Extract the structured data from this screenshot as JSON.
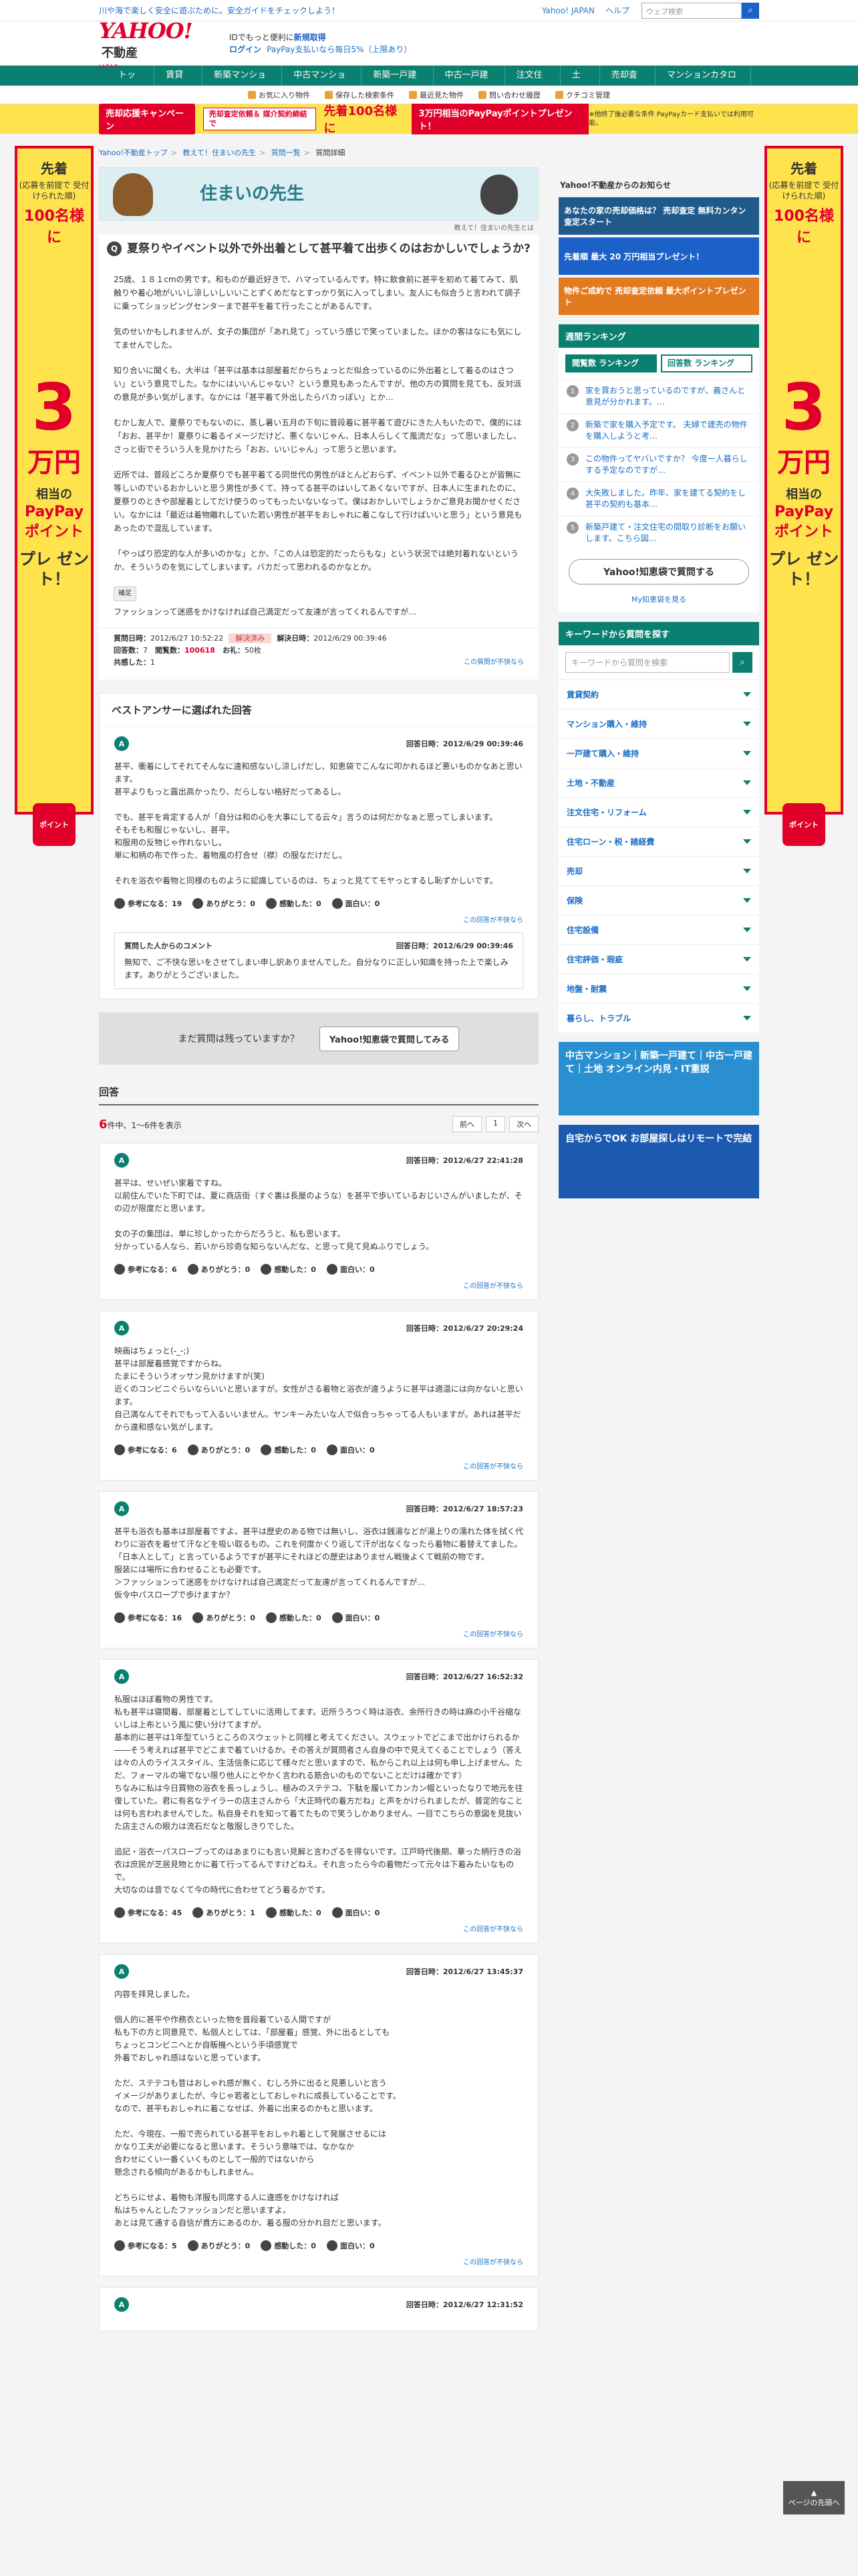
{
  "topbar": {
    "msg": "川や海で楽しく安全に遊ぶために。安全ガイドをチェックしよう！",
    "yahoo": "Yahoo! JAPAN",
    "help": "ヘルプ",
    "search_placeholder": "ウェブ検索"
  },
  "header": {
    "logo": "YAHOO!",
    "logo_sub": "JAPAN",
    "category": "不動産",
    "l1": "IDでもっと便利に",
    "l1b": "新規取得",
    "login": "ログイン",
    "paypay": "PayPay支払いなら毎日5%（上限あり）"
  },
  "gnav": [
    "トップ",
    "賃貸 ▼",
    "新築マンション",
    "中古マンション",
    "新築一戸建て",
    "中古一戸建て",
    "注文住宅",
    "土地",
    "売却査定",
    "マンションカタログ"
  ],
  "subnav": [
    "お気に入り物件",
    "保存した検索条件",
    "最近見た物件",
    "問い合わせ履歴",
    "クチコミ管理"
  ],
  "banner": {
    "b1": "売却応援キャンペーン",
    "b2": "売却査定依頼＆\n媒介契約締結で",
    "b3": "先着100名様に",
    "b4": "3万円相当のPayPayポイントプレゼント！",
    "b5": "※他終了後必要な条件\nPayPayカード支払いでは利用可能。"
  },
  "sidead": {
    "a1": "先着",
    "a2": "(応募を前提で\n受付けられた順)",
    "a3": "100名様に",
    "a4": "3",
    "a5": "万円",
    "a6": "相当の",
    "a7": "PayPay\nポイント",
    "a8": "プレ\nゼント！",
    "logo": "ポイント"
  },
  "breadcrumb": [
    "Yahoo!不動産トップ",
    "教えて！住まいの先生",
    "質問一覧",
    "質問詳細"
  ],
  "teach": {
    "title": "住まいの先生",
    "note": "教えて！住まいの先生とは"
  },
  "question": {
    "title": "夏祭りやイベント以外で外出着として甚平着て出歩くのはおかしいでしょうか?",
    "paras": [
      "25歳、１８１cmの男です。和ものが最近好きで、ハマっているんです。特に飲食前に甚平を初めて着てみて、肌触りや着心地がいいし涼しいしいいことずくめだなとすっかり気に入ってしまい。友人にも似合うと言われて調子に乗ってショッピングセンターまで甚平を着て行ったことがあるんです。",
      "気のせいかもしれませんが、女子の集団が「あれ見て」っていう感じで笑っていました。ほかの客はなにも気にしてませんでした。",
      "知り合いに聞くも、大半は「甚平は基本は部屋着だからちょっとだ似合っているのに外出着として着るのはさつい」という意見でした。なかにはいいんじゃない？という意見もあったんですが、他の方の質問を見ても、反対派の意見が多い気がします。なかには「甚平着て外出したらバカっぽい」とか…",
      "むかし友人で、夏祭りでもないのに、蒸し暑い五月の下旬に普段着に甚平着て遊びにきた人もいたので、僕的には「おお、甚平か！夏祭りに着るイメージだけど、悪くないじゃん、日本人らしくて風流だな」って思いましたし、さっと街でそういう人を見かけたら「おお、いいじゃん」って思うと思います。",
      "近所では、普段どころか夏祭りでも甚平着てる同世代の男性がほとんどおらず、イベント以外で着るひとが皆無に等しいのでいるおかしいと思う男性が多くて、持ってる甚平のはいしてあくないですが、日本人に生まれたのに、夏祭りのときや部屋着としてだけ使うのってもったいないなって。僕はおかしいでしょうかご意見お聞かせください。なかには「最近は着物離れしていた若い男性が甚平をおしゃれに着こなして行けばいいと思う」という意見もあったので混乱しています。",
      "「やっぱり恐定的な人が多いのかな」とか、「この人は恐定的だったらもな」という状況では絶対着れないというか、そういうのを気にしてしまいます。バカだって思われるのかなとか。"
    ],
    "hosoku": "補足",
    "hosoku_text": "ファッションって迷惑をかけなければ自己満定だって友達が言ってくれるんですが…",
    "date_label": "質問日時：",
    "date": "2012/6/27 10:52:22",
    "solved": "解決済み",
    "sdate_label": "解決日時：",
    "sdate": "2012/6/29 00:39:46",
    "ans_label": "回答数：",
    "ans": "7",
    "views_label": "閲覧数：",
    "views": "100618",
    "coin_label": "お礼：",
    "coin": "50枚",
    "agree_label": "共感した：",
    "agree": "1",
    "inapp": "この質問が不快なら"
  },
  "best": {
    "head": "ベストアンサーに選ばれた回答",
    "date": "回答日時：2012/6/29 00:39:46",
    "body": "甚平、衝着にしてそれてそんなに違和感ないし涼しげだし、知恵袋でこんなに叩かれるほど悪いものかなあと思います。\n甚平よりもっと露出高かったり、だらしない格好だってあるし。\n\nでも、甚平を肯定する人が「自分は和の心を大事にしてる云々」言うのは何だかなぁと思ってしまいます。\nそもそも和服じゃないし、甚平。\n和服用の反物じゃ作れないし。\n単に和柄の布で作った、着物風の打合せ（襟）の服なだけだし。\n\nそれを浴衣や着物と同様のものように認識しているのは、ちょっと見ててモヤっとするし恥ずかしいです。",
    "reacts": [
      "参考になる：19",
      "ありがとう：0",
      "感動した：0",
      "面白い：0"
    ],
    "inapp": "この回答が不快なら",
    "c_head": "質問した人からのコメント",
    "c_date": "回答日時：2012/6/29 00:39:46",
    "c_body": "無知で、ご不快な思いをさせてしまい申し訳ありませんでした。自分なりに正しい知識を持った上で楽しみます。ありがとうございました。"
  },
  "still": {
    "text": "まだ質問は残っていますか？",
    "btn": "Yahoo!知恵袋で質問してみる"
  },
  "answers": {
    "heading": "回答",
    "count": "6",
    "count_text": "件中、1〜6件を表示",
    "prev": "前へ",
    "page": "1",
    "next": "次へ",
    "items": [
      {
        "date": "回答日時：2012/6/27 22:41:28",
        "body": "甚平は、せいぜい家着ですね。\n以前住んでいた下町では、夏に商店街（すぐ裏は長屋のような）を甚平で歩いているおじいさんがいましたが、その辺が限度だと思います。\n\n女の子の集団は、単に珍しかったからだろうと、私も思います。\n分かっている人なら、若いから珍奇な知らないんだな、と思って見て見ぬふりでしょう。",
        "r": [
          "参考になる：6",
          "ありがとう：0",
          "感動した：0",
          "面白い：0"
        ]
      },
      {
        "date": "回答日時：2012/6/27 20:29:24",
        "body": "映画はちょっと(-_-;)\n甚平は部屋着感覚ですからね。\nたまにそういうオッサン見かけますが(笑)\n近くのコンビニぐらいならいいと思いますが。女性がさる着物と浴衣が違うように甚平は適温には向かないと思います。\n自己満なんてそれでもって入るいいません。ヤンキーみたいな人で似合っちゃってる人もいますが。あれは甚平だから違和感ない気がします。",
        "r": [
          "参考になる：6",
          "ありがとう：0",
          "感動した：0",
          "面白い：0"
        ]
      },
      {
        "date": "回答日時：2012/6/27 18:57:23",
        "body": "甚平も浴衣も基本は部屋着ですよ。甚平は歴史のある物では無いし、浴衣は銭湯などが湯上りの濡れた体を拭く代わりに浴衣を着せて汗などを吸い取るもの。これを何度かくり返して汗が出なくなったら着物に着替えてました。\n「日本人として」と言っているようですが甚平にそれほどの歴史はありません戦後よくて戦前の物です。\n服装には場所に合わせることも必要です。\n＞ファッションって迷惑をかけなければ自己満定だって友達が言ってくれるんですが…\n仮令中パスローブで歩けますか？",
        "r": [
          "参考になる：16",
          "ありがとう：0",
          "感動した：0",
          "面白い：0"
        ]
      },
      {
        "date": "回答日時：2012/6/27 16:52:32",
        "body": "私服はほぼ着物の男性です。\n私も甚平は寝間着、部屋着としてしていに活用してます。近所うろつく時は浴衣、余所行きの時は麻の小千谷縮ないしは上布という風に使い分けてますが。\n基本的に甚平は1年型ていうところのスウェットと同様と考えてください。スウェットでどこまで出かけられるか――そう考えれば甚平でどこまで着ていけるか。その答えが質問者さん自身の中で見えてくることでしょう（答えは々の人のライススタイル、生活信条に応じて様々だと思いますので、私からこれ以上は何も申し上げません。ただ、フォーマルの場でない限り他人にとやかく言われる筋合いのものでないことだけは確かです）\nちなみに私は今日買物の浴衣を長っしょうし、極みのステテコ、下駄を履いてカンカン帽といったなりで地元を往復していた。君に有名なテイラーの店主さんから「大正時代の着方だね」と声をかけられましたが、普定的なことは何も言われませんでした。私自身それを知って着てたもので笑うしかありません、一目でこちらの意図を見抜いた店主さんの眼力は流石だなと敬服しきりでした。\n\n追記・浴衣ーパスローブってのはあまりにも言い見解と言わざるを得ないです。江戸時代後期、華った柄行きの浴衣は庶民が芝居見物とかに着て行ってるんですけどねえ。それ言ったら今の着物だって元々は下着みたいなもので。\n大切なのは昔でなくて今の時代に合わせてどう着るかです。",
        "r": [
          "参考になる：45",
          "ありがとう：1",
          "感動した：0",
          "面白い：0"
        ]
      },
      {
        "date": "回答日時：2012/6/27 13:45:37",
        "body": "内容を拝見しました。\n\n個人的に甚平や作務衣といった物を普段着ている人間ですが\n私も下の方と同意見で、私個人としては、「部屋着」感覚、外に出るとしても\nちょっとコンビニへとか自販機へという手頃感覚で\n外着でおしゃれ感はないと思っています。\n\nただ、ステテコも昔はおしゃれ感が無く、むしろ外に出ると見悪しいと言う\nイメージがありましたが、今じゃ若者としておしゃれに成長していることです。\nなので、甚平もおしゃれに着こなせば、外着に出来るのかもと思います。\n\nただ、今現在、一般で売られている甚平をおしゃれ着として発展させるには\nかなり工夫が必要になると思います。そういう意味では、なかなか\n合わせにくい一番くいくものとして一般的ではないから\n懸念される傾向があるかもしれません。\n\nどちらにせよ、着物も洋服も同席する人に違感をかけなければ\n私はちゃんとしたファッションだと思いますよ。\nあとは見て通する自信が貴方にあるのか、着る服の分かれ目だと思います。",
        "r": [
          "参考になる：5",
          "ありがとう：0",
          "感動した：0",
          "面白い：0"
        ]
      },
      {
        "date": "回答日時：2012/6/27 12:31:52",
        "body": "",
        "r": [
          "参考になる：0",
          "ありがとう：0",
          "感動した：0",
          "面白い：0"
        ]
      }
    ],
    "inapp": "この回答が不快なら"
  },
  "side": {
    "notice": "Yahoo!不動産からのお知らせ",
    "ad1": "あなたの家の売却価格は？ 売却査定 無料カンタン 査定スタート",
    "ad2": "先着順 最大 20 万円相当プレゼント！",
    "ad3": "物件ご成約で 売却査定依頼 最大ポイントプレゼント",
    "rank_h": "週間ランキング",
    "tab1": "閲覧数\nランキング",
    "tab2": "回答数\nランキング",
    "rank": [
      "家を買おうと思っているのですが、義さんと意見が分かれます。…",
      "新築で家を購入予定です。 夫婦で建売の物件を購入しようと考…",
      "この物件ってヤバいですか？ 今度一人暮らしする予定なのですが…",
      "大失敗しました。昨年、家を建てる契約をし甚平の契約も基本…",
      "新築戸建て・注文住宅の間取り診断をお願いします。こちら図…"
    ],
    "ask": "Yahoo!知恵袋で質問する",
    "mine": "My知恵袋を見る",
    "kw_h": "キーワードから質問を探す",
    "kw_ph": "キーワードから質問を検索",
    "cats": [
      "賃貸契約",
      "マンション購入・維持",
      "一戸建て購入・維持",
      "土地・不動産",
      "注文住宅・リフォーム",
      "住宅ローン・税・諸経費",
      "売却",
      "保険",
      "住宅設備",
      "住宅評価・瑕疵",
      "地盤・耐震",
      "暮らし、トラブル"
    ],
    "p1": "中古マンション｜新築一戸建て｜中古一戸建て｜土地 オンライン内見・IT重説",
    "p2": "自宅からでOK お部屋探しはリモートで完結"
  },
  "pagetop": "ページの先頭へ"
}
